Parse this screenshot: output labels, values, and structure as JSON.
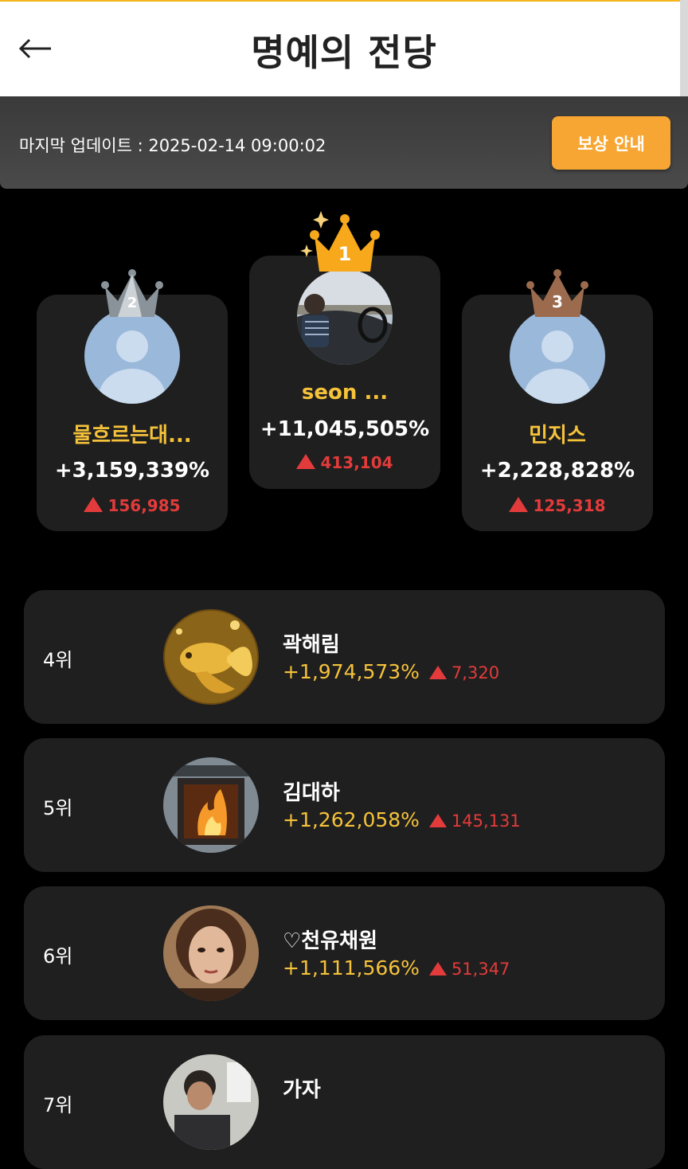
{
  "header": {
    "title": "명예의 전당"
  },
  "update_bar": {
    "last_update": "마지막 업데이트 : 2025-02-14 09:00:02",
    "reward_button": "보상 안내"
  },
  "podium": [
    {
      "rank": "1",
      "name": "seon ...",
      "percent": "+11,045,505%",
      "change": "413,104",
      "crown_color": "#f7a81b"
    },
    {
      "rank": "2",
      "name": "물흐르는대...",
      "percent": "+3,159,339%",
      "change": "156,985",
      "crown_color": "#8a9399"
    },
    {
      "rank": "3",
      "name": "민지스",
      "percent": "+2,228,828%",
      "change": "125,318",
      "crown_color": "#9c6b4e"
    }
  ],
  "rankings": [
    {
      "rank": "4위",
      "name": "곽해림",
      "percent": "+1,974,573%",
      "change": "7,320",
      "avatar": "golden-fish"
    },
    {
      "rank": "5위",
      "name": "김대하",
      "percent": "+1,262,058%",
      "change": "145,131",
      "avatar": "fireplace"
    },
    {
      "rank": "6위",
      "name": "♡천유채원",
      "percent": "+1,111,566%",
      "change": "51,347",
      "avatar": "portrait-woman"
    },
    {
      "rank": "7위",
      "name": "가자",
      "percent": "",
      "change": "",
      "avatar": "portrait-man"
    }
  ],
  "colors": {
    "accent": "#f7a633",
    "gold_text": "#f5c23a",
    "up_red": "#e33b3b"
  }
}
